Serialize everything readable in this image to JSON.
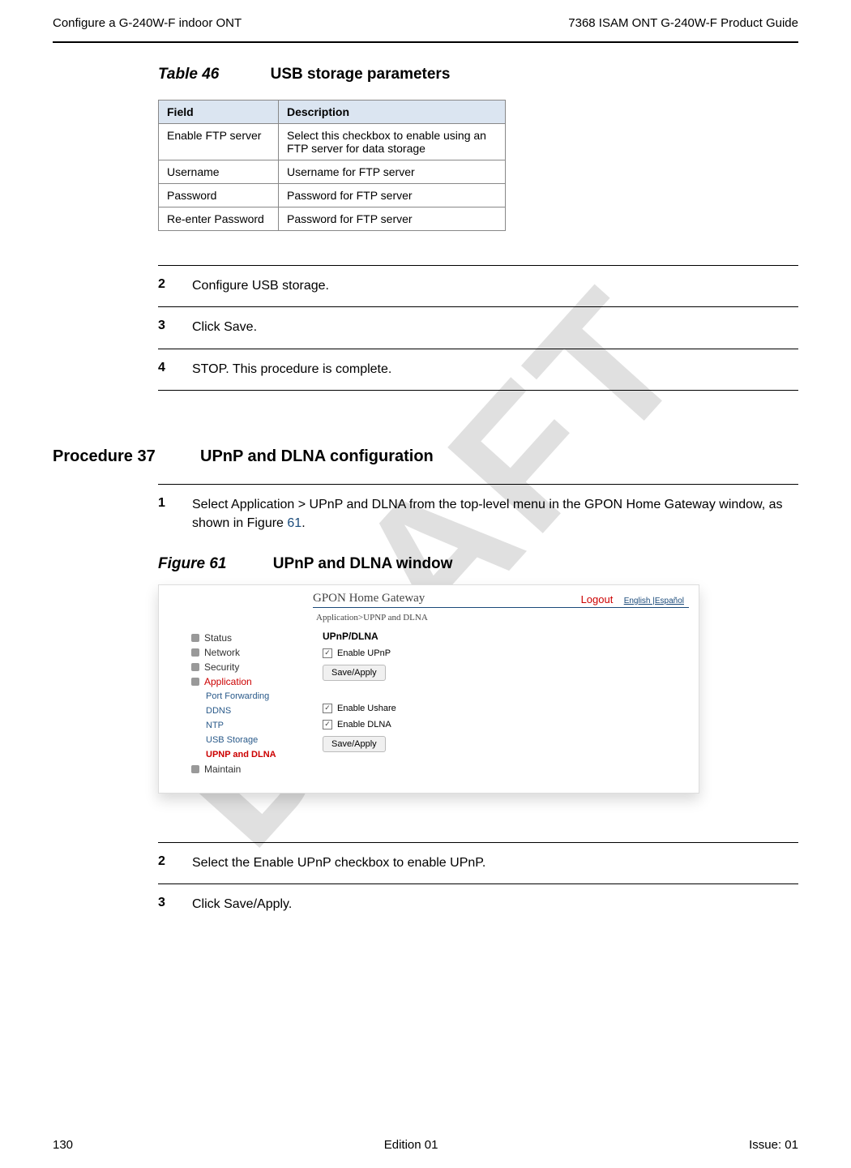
{
  "header": {
    "left": "Configure a G-240W-F indoor ONT",
    "right": "7368 ISAM ONT G-240W-F Product Guide"
  },
  "watermark": "DRAFT",
  "table46": {
    "caption_num": "Table 46",
    "caption_title": "USB storage parameters",
    "cols": [
      "Field",
      "Description"
    ],
    "rows": [
      [
        "Enable FTP server",
        "Select this checkbox to enable using an FTP server for data storage"
      ],
      [
        "Username",
        "Username for FTP server"
      ],
      [
        "Password",
        "Password for FTP server"
      ],
      [
        "Re-enter Password",
        "Password for FTP server"
      ]
    ]
  },
  "steps_block1": [
    {
      "num": "2",
      "text": "Configure USB storage."
    },
    {
      "num": "3",
      "text": "Click Save."
    },
    {
      "num": "4",
      "text": "STOP. This procedure is complete."
    }
  ],
  "procedure": {
    "label": "Procedure 37",
    "title": "UPnP and DLNA configuration"
  },
  "step_p37_1": {
    "num": "1",
    "pre": "Select Application > UPnP and DLNA from the top-level menu in the GPON Home Gateway window, as shown in Figure ",
    "link": "61",
    "post": "."
  },
  "figure61": {
    "caption_num": "Figure 61",
    "caption_title": "UPnP and DLNA window"
  },
  "screenshot": {
    "brand": "GPON Home Gateway",
    "logout": "Logout",
    "lang": "English |Español",
    "breadcrumb": "Application>UPNP and DLNA",
    "sidebar": {
      "top": [
        "Status",
        "Network",
        "Security"
      ],
      "active": "Application",
      "sub": [
        "Port Forwarding",
        "DDNS",
        "NTP",
        "USB Storage"
      ],
      "sub_active": "UPNP and DLNA",
      "bottom": [
        "Maintain"
      ]
    },
    "main": {
      "section": "UPnP/DLNA",
      "check_upnp": "Enable UPnP",
      "btn1": "Save/Apply",
      "check_ushare": "Enable Ushare",
      "check_dlna": "Enable DLNA",
      "btn2": "Save/Apply"
    }
  },
  "steps_block2": [
    {
      "num": "2",
      "text": "Select the Enable UPnP checkbox to enable UPnP."
    },
    {
      "num": "3",
      "text": "Click Save/Apply."
    }
  ],
  "footer": {
    "left": "130",
    "center": "Edition 01",
    "right": "Issue: 01"
  }
}
